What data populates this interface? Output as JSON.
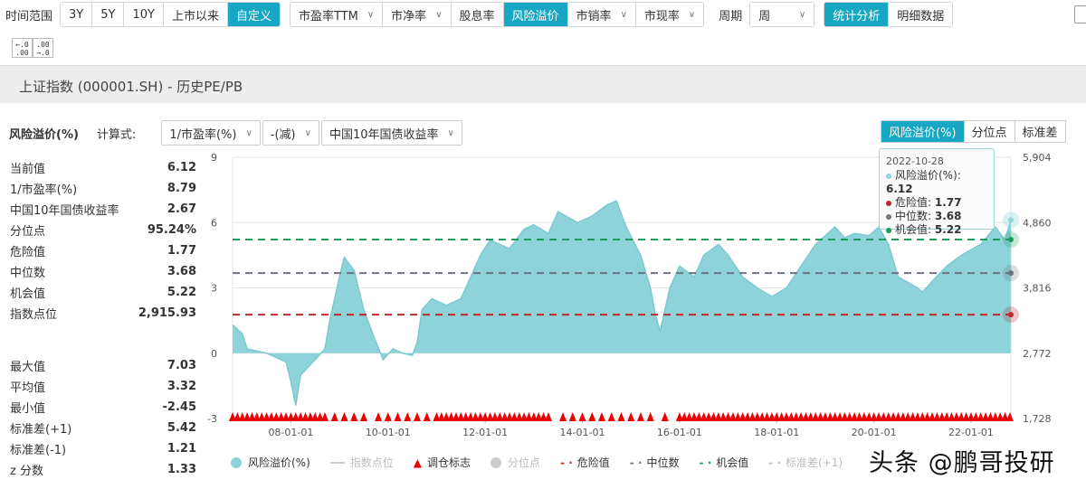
{
  "toolbar": {
    "time_label": "时间范围",
    "time_ranges": [
      "3Y",
      "5Y",
      "10Y",
      "上市以来",
      "自定义"
    ],
    "metrics": [
      "市盈率TTM",
      "市净率",
      "股息率",
      "风险溢价",
      "市销率",
      "市现率"
    ],
    "period_label": "周期",
    "period_value": "周",
    "views": [
      "统计分析",
      "明细数据"
    ],
    "precision": [
      "←.0 .00",
      ".00 →.0"
    ]
  },
  "title": "上证指数 (000001.SH) - 历史PE/PB",
  "controls": {
    "metric_title": "风险溢价(%)",
    "formula_label": "计算式:",
    "formula_a": "1/市盈率(%)",
    "operator": "-(减)",
    "formula_b": "中国10年国债收益率"
  },
  "right_tabs": [
    "风险溢价(%)",
    "分位点",
    "标准差"
  ],
  "stats_top": [
    {
      "k": "当前值",
      "v": "6.12"
    },
    {
      "k": "1/市盈率(%)",
      "v": "8.79"
    },
    {
      "k": "中国10年国债收益率",
      "v": "2.67"
    },
    {
      "k": "分位点",
      "v": "95.24%"
    },
    {
      "k": "危险值",
      "v": "1.77"
    },
    {
      "k": "中位数",
      "v": "3.68"
    },
    {
      "k": "机会值",
      "v": "5.22"
    },
    {
      "k": "指数点位",
      "v": "2,915.93"
    }
  ],
  "stats_bottom": [
    {
      "k": "最大值",
      "v": "7.03"
    },
    {
      "k": "平均值",
      "v": "3.32"
    },
    {
      "k": "最小值",
      "v": "-2.45"
    },
    {
      "k": "标准差(+1)",
      "v": "5.42"
    },
    {
      "k": "标准差(-1)",
      "v": "1.21"
    },
    {
      "k": "z 分数",
      "v": "1.33"
    }
  ],
  "tooltip": {
    "date": "2022-10-28",
    "rows": [
      {
        "k": "风险溢价(%): ",
        "v": "6.12",
        "color": "#8fd0d9"
      },
      {
        "k": "危险值: ",
        "v": "1.77",
        "color": "#c0272d"
      },
      {
        "k": "中位数: ",
        "v": "3.68",
        "color": "#777777"
      },
      {
        "k": "机会值: ",
        "v": "5.22",
        "color": "#1e9a5a"
      }
    ]
  },
  "legend": [
    "风险溢价(%)",
    "指数点位",
    "调仓标志",
    "分位点",
    "危险值",
    "中位数",
    "机会值",
    "标准差(+1)"
  ],
  "watermark": "头条 @鹏哥投研",
  "colors": {
    "accent": "#17a7c3",
    "area": "#8fd3da",
    "danger": "#c0272d",
    "median": "#6d7280",
    "opportunity": "#1e9a5a"
  },
  "chart_data": {
    "type": "area",
    "ylim": [
      -3,
      9
    ],
    "yticks": [
      "-3",
      "0",
      "3",
      "6",
      "9"
    ],
    "y2ticks": [
      "1,728",
      "2,772",
      "3,816",
      "4,860",
      "5,904"
    ],
    "xlim": [
      2006.8,
      2022.82
    ],
    "xticks": [
      {
        "v": 2008,
        "l": "08-01-01"
      },
      {
        "v": 2010,
        "l": "10-01-01"
      },
      {
        "v": 2012,
        "l": "12-01-01"
      },
      {
        "v": 2014,
        "l": "14-01-01"
      },
      {
        "v": 2016,
        "l": "16-01-01"
      },
      {
        "v": 2018,
        "l": "18-01-01"
      },
      {
        "v": 2020,
        "l": "20-01-01"
      },
      {
        "v": 2022,
        "l": "22-01-01"
      }
    ],
    "lines": {
      "danger": 1.77,
      "median": 3.68,
      "opportunity": 5.22
    },
    "series": [
      [
        2006.8,
        1.3
      ],
      [
        2007.0,
        0.9
      ],
      [
        2007.1,
        0.2
      ],
      [
        2007.5,
        0
      ],
      [
        2007.9,
        -0.4
      ],
      [
        2008.0,
        -1.3
      ],
      [
        2008.1,
        -2.4
      ],
      [
        2008.2,
        -1.0
      ],
      [
        2008.5,
        -0.3
      ],
      [
        2008.7,
        0.2
      ],
      [
        2008.8,
        1.5
      ],
      [
        2009.0,
        3.5
      ],
      [
        2009.1,
        4.4
      ],
      [
        2009.3,
        3.8
      ],
      [
        2009.5,
        2.0
      ],
      [
        2009.7,
        0.8
      ],
      [
        2009.9,
        -0.3
      ],
      [
        2010.1,
        0.2
      ],
      [
        2010.3,
        0
      ],
      [
        2010.5,
        -0.1
      ],
      [
        2010.6,
        0.5
      ],
      [
        2010.7,
        2.0
      ],
      [
        2010.9,
        2.5
      ],
      [
        2011.2,
        2.2
      ],
      [
        2011.5,
        2.5
      ],
      [
        2011.7,
        3.5
      ],
      [
        2011.9,
        4.5
      ],
      [
        2012.1,
        5.2
      ],
      [
        2012.5,
        4.8
      ],
      [
        2012.8,
        5.7
      ],
      [
        2013.0,
        5.9
      ],
      [
        2013.3,
        5.5
      ],
      [
        2013.5,
        6.5
      ],
      [
        2013.9,
        6.0
      ],
      [
        2014.2,
        6.3
      ],
      [
        2014.5,
        6.8
      ],
      [
        2014.7,
        7.0
      ],
      [
        2014.9,
        5.8
      ],
      [
        2015.2,
        4.5
      ],
      [
        2015.4,
        3.0
      ],
      [
        2015.5,
        1.8
      ],
      [
        2015.6,
        1.0
      ],
      [
        2015.8,
        3.0
      ],
      [
        2016.0,
        4.0
      ],
      [
        2016.3,
        3.5
      ],
      [
        2016.5,
        4.5
      ],
      [
        2016.8,
        5.0
      ],
      [
        2017.0,
        4.5
      ],
      [
        2017.3,
        3.5
      ],
      [
        2017.6,
        3.0
      ],
      [
        2017.9,
        2.6
      ],
      [
        2018.2,
        3.0
      ],
      [
        2018.5,
        4.0
      ],
      [
        2018.8,
        5.0
      ],
      [
        2019.2,
        5.8
      ],
      [
        2019.4,
        5.3
      ],
      [
        2019.6,
        5.5
      ],
      [
        2019.9,
        5.4
      ],
      [
        2020.1,
        5.8
      ],
      [
        2020.3,
        5.0
      ],
      [
        2020.5,
        3.5
      ],
      [
        2020.9,
        3.0
      ],
      [
        2021.0,
        2.8
      ],
      [
        2021.2,
        3.3
      ],
      [
        2021.5,
        4.0
      ],
      [
        2021.8,
        4.5
      ],
      [
        2022.2,
        5.0
      ],
      [
        2022.5,
        5.8
      ],
      [
        2022.7,
        5.2
      ],
      [
        2022.82,
        6.12
      ]
    ],
    "rebalance_marks": [
      2006.8,
      2006.9,
      2007.0,
      2007.1,
      2007.2,
      2007.3,
      2007.4,
      2007.5,
      2007.6,
      2007.7,
      2007.8,
      2007.9,
      2008.0,
      2008.1,
      2008.2,
      2008.3,
      2008.4,
      2008.5,
      2008.6,
      2008.7,
      2008.9,
      2009.1,
      2009.3,
      2009.5,
      2009.8,
      2010.0,
      2010.2,
      2010.4,
      2010.6,
      2010.8,
      2011.0,
      2011.1,
      2011.2,
      2011.3,
      2011.4,
      2011.5,
      2011.6,
      2011.7,
      2011.8,
      2011.9,
      2012.0,
      2012.1,
      2012.2,
      2012.3,
      2012.4,
      2012.5,
      2012.6,
      2012.7,
      2012.8,
      2012.9,
      2013.0,
      2013.1,
      2013.2,
      2013.3,
      2013.6,
      2013.8,
      2014.0,
      2014.2,
      2014.4,
      2014.6,
      2014.8,
      2015.0,
      2015.2,
      2015.4,
      2015.7,
      2016.0,
      2016.1,
      2016.2,
      2016.3,
      2016.4,
      2016.5,
      2016.6,
      2016.7,
      2016.8,
      2016.9,
      2017.0,
      2017.1,
      2017.2,
      2017.3,
      2017.4,
      2017.5,
      2017.6,
      2017.7,
      2017.8,
      2017.9,
      2018.0,
      2018.1,
      2018.2,
      2018.3,
      2018.4,
      2018.5,
      2018.6,
      2018.7,
      2018.8,
      2018.9,
      2019.0,
      2019.1,
      2019.2,
      2019.3,
      2019.4,
      2019.5,
      2019.6,
      2019.7,
      2019.8,
      2019.9,
      2020.0,
      2020.1,
      2020.2,
      2020.3,
      2020.4,
      2020.5,
      2020.6,
      2020.7,
      2020.8,
      2020.9,
      2021.0,
      2021.1,
      2021.2,
      2021.3,
      2021.4,
      2021.5,
      2021.6,
      2021.7,
      2021.8,
      2021.9,
      2022.0,
      2022.1,
      2022.2,
      2022.3,
      2022.4,
      2022.5,
      2022.6,
      2022.7,
      2022.8
    ]
  }
}
